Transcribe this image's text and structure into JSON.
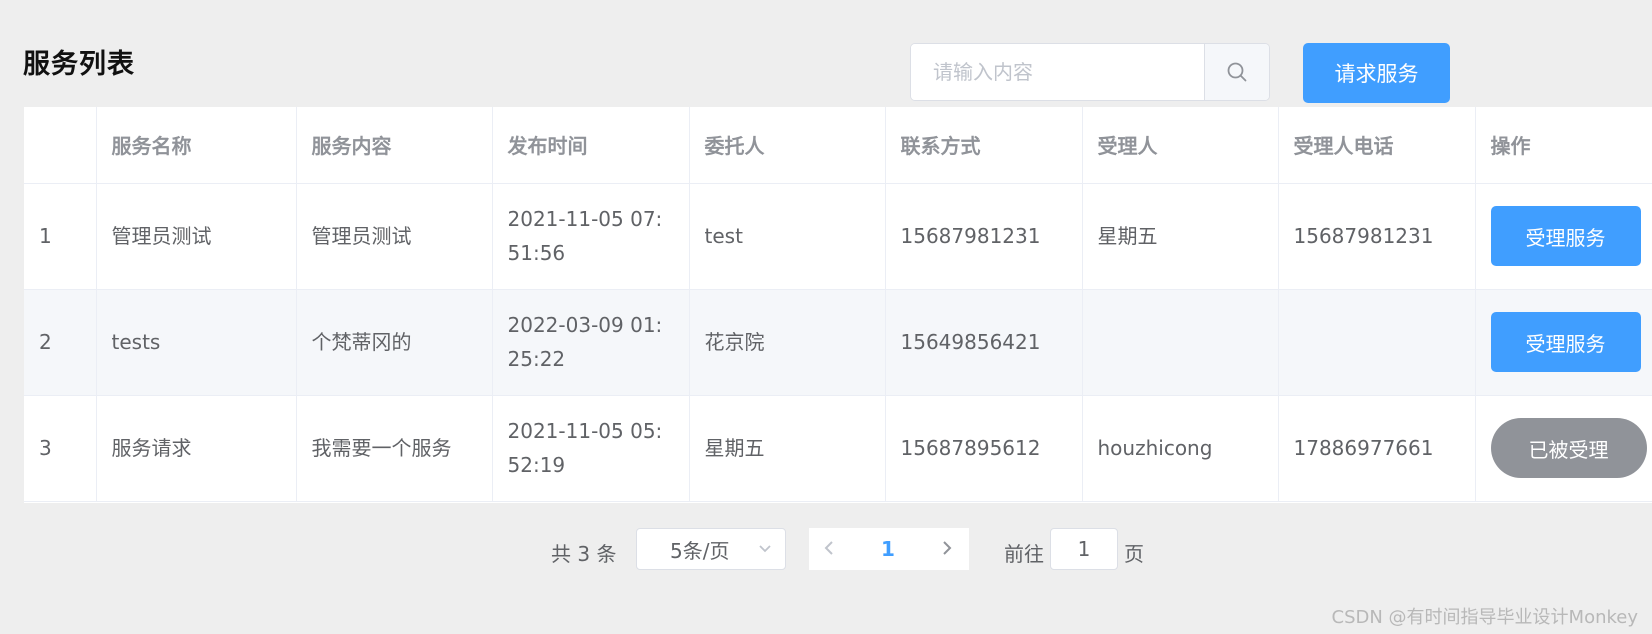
{
  "page_title": "服务列表",
  "search": {
    "placeholder": "请输入内容",
    "value": ""
  },
  "request_button": "请求服务",
  "table": {
    "headers": [
      "",
      "服务名称",
      "服务内容",
      "发布时间",
      "委托人",
      "联系方式",
      "受理人",
      "受理人电话",
      "操作"
    ],
    "rows": [
      {
        "index": "1",
        "name": "管理员测试",
        "content": "管理员测试",
        "time": "2021-11-05 07:51:56",
        "client": "test",
        "contact": "15687981231",
        "handler": "星期五",
        "handler_phone": "15687981231",
        "action": "受理服务",
        "action_state": "available"
      },
      {
        "index": "2",
        "name": "tests",
        "content": "个梵蒂冈的",
        "time": "2022-03-09 01:25:22",
        "client": "花京院",
        "contact": "15649856421",
        "handler": "",
        "handler_phone": "",
        "action": "受理服务",
        "action_state": "available"
      },
      {
        "index": "3",
        "name": "服务请求",
        "content": "我需要一个服务",
        "time": "2021-11-05 05:52:19",
        "client": "星期五",
        "contact": "15687895612",
        "handler": "houzhicong",
        "handler_phone": "17886977661",
        "action": "已被受理",
        "action_state": "accepted"
      }
    ]
  },
  "pagination": {
    "total": "共 3 条",
    "page_size": "5条/页",
    "current_page": "1",
    "goto_label": "前往",
    "goto_value": "1",
    "goto_suffix": "页"
  },
  "watermark": "CSDN @有时间指导毕业设计Monkey",
  "colors": {
    "primary": "#409eff",
    "disabled": "#909399",
    "background": "#eeeeee"
  }
}
